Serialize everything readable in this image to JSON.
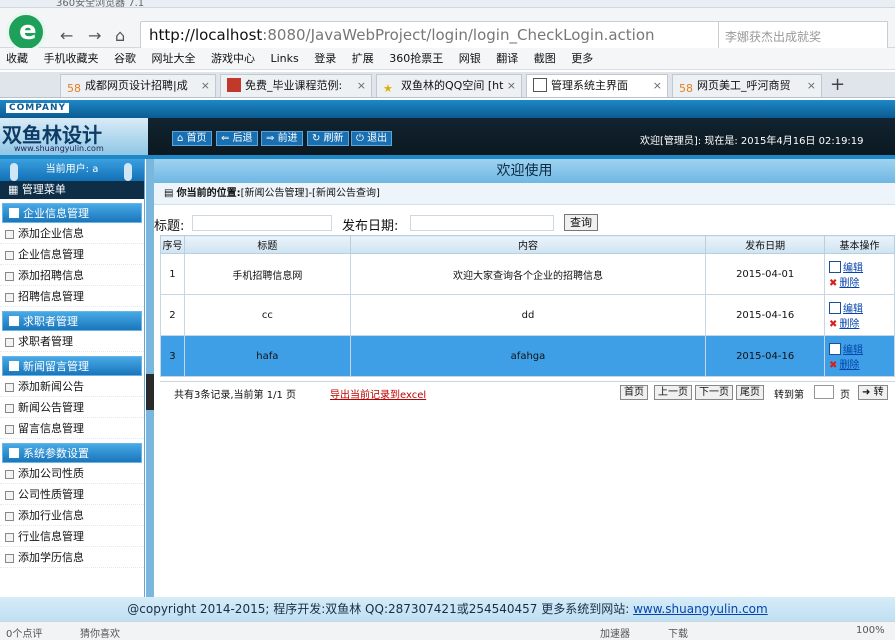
{
  "browser": {
    "title": "360安全浏览器 7.1",
    "url_host": "http://localhost",
    "url_rest": ":8080/JavaWebProject/login/login_CheckLogin.action",
    "search_placeholder": "李娜获杰出成就奖",
    "bookmarks": [
      "收藏",
      "手机收藏夹",
      "谷歌",
      "网址大全",
      "游戏中心",
      "Links",
      "登录",
      "扩展",
      "360抢票王",
      "网银",
      "翻译",
      "截图",
      "更多"
    ],
    "tabs": [
      {
        "label": "成都网页设计招聘|成",
        "active": false
      },
      {
        "label": "免费_毕业课程范例:",
        "active": false
      },
      {
        "label": "双鱼林的QQ空间 [ht",
        "active": false
      },
      {
        "label": "管理系统主界面",
        "active": true
      },
      {
        "label": "网页美工_呼河商贸",
        "active": false
      }
    ]
  },
  "app": {
    "company_tag": "COMPANY",
    "brand": "双鱼林设计",
    "brand_url": "www.shuangyulin.com",
    "nav": {
      "home": "首页",
      "back": "后退",
      "forward": "前进",
      "refresh": "刷新",
      "logout": "退出"
    },
    "welcome": "欢迎[管理员]:  现在是: 2015年4月16日 02:19:19",
    "current_user_label": "当前用户: a",
    "menu_title": "管理菜单",
    "groups": [
      {
        "title": "企业信息管理",
        "items": [
          "添加企业信息",
          "企业信息管理",
          "添加招聘信息",
          "招聘信息管理"
        ]
      },
      {
        "title": "求职者管理",
        "items": [
          "求职者管理"
        ]
      },
      {
        "title": "新闻留言管理",
        "items": [
          "添加新闻公告",
          "新闻公告管理",
          "留言信息管理"
        ]
      },
      {
        "title": "系统参数设置",
        "items": [
          "添加公司性质",
          "公司性质管理",
          "添加行业信息",
          "行业信息管理",
          "添加学历信息"
        ]
      }
    ]
  },
  "main": {
    "title": "欢迎使用",
    "position_label": "你当前的位置:",
    "position_value": "[新闻公告管理]-[新闻公告查询]",
    "filter": {
      "title_label": "标题:",
      "date_label": "发布日期:",
      "query_button": "查询"
    },
    "columns": [
      "序号",
      "标题",
      "内容",
      "发布日期",
      "基本操作"
    ],
    "rows": [
      {
        "no": "1",
        "title": "手机招聘信息网",
        "content": "欢迎大家查询各个企业的招聘信息",
        "date": "2015-04-01",
        "selected": false
      },
      {
        "no": "2",
        "title": "cc",
        "content": "dd",
        "date": "2015-04-16",
        "selected": false
      },
      {
        "no": "3",
        "title": "hafa",
        "content": "afahga",
        "date": "2015-04-16",
        "selected": true
      }
    ],
    "op_edit": "编辑",
    "op_delete": "删除",
    "pager": {
      "info": "共有3条记录,当前第 1/1 页",
      "export": "导出当前记录到excel",
      "first": "首页",
      "prev": "上一页",
      "next": "下一页",
      "last": "尾页",
      "goto_label": "转到第",
      "page_unit": "页",
      "go": "转"
    }
  },
  "footer": {
    "text": "@copyright 2014-2015; 程序开发:双鱼林  QQ:287307421或254540457  更多系统到网站: ",
    "link": "www.shuangyulin.com"
  },
  "statusbar": {
    "left1": "0个点评",
    "left2": "猜你喜欢",
    "accel": "加速器",
    "download": "下载",
    "zoom": "100%"
  },
  "colors": {
    "accent": "#1e88c7",
    "selected_row": "#3f9fe6",
    "header_dark": "#0b1820"
  }
}
